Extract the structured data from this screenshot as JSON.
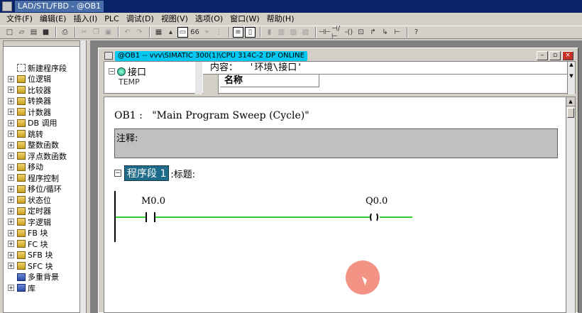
{
  "app": {
    "title": "LAD/STL/FBD  - @OB1"
  },
  "menu": [
    {
      "label": "文件(F)"
    },
    {
      "label": "编辑(E)"
    },
    {
      "label": "插入(I)"
    },
    {
      "label": "PLC"
    },
    {
      "label": "调试(D)"
    },
    {
      "label": "视图(V)"
    },
    {
      "label": "选项(O)"
    },
    {
      "label": "窗口(W)"
    },
    {
      "label": "帮助(H)"
    }
  ],
  "toolbar": {
    "buttons": [
      {
        "icon": "□"
      },
      {
        "icon": "▱"
      },
      {
        "icon": "▤"
      },
      {
        "icon": "■"
      },
      {
        "icon": "⎙"
      },
      {
        "icon": "✂"
      },
      {
        "icon": "❐"
      },
      {
        "icon": "▣"
      },
      {
        "icon": "↶"
      },
      {
        "icon": "↷"
      },
      {
        "icon": "▦"
      },
      {
        "icon": "▴"
      },
      {
        "icon": "▭"
      },
      {
        "icon": "66"
      },
      {
        "icon": "⌖"
      },
      {
        "icon": "⋮"
      },
      {
        "icon": "≡"
      },
      {
        "icon": "▯"
      },
      {
        "icon": "▮"
      },
      {
        "icon": "▥"
      },
      {
        "icon": "▧"
      },
      {
        "icon": "▨"
      },
      {
        "icon": "⊣⊢"
      },
      {
        "icon": "⊣/⊢"
      },
      {
        "icon": "-()"
      },
      {
        "icon": "⊡"
      },
      {
        "icon": "↱"
      },
      {
        "icon": "↳"
      },
      {
        "icon": "⊢"
      },
      {
        "icon": "?"
      }
    ]
  },
  "catalog": {
    "items": [
      {
        "label": "新建程序段",
        "expandable": false
      },
      {
        "label": "位逻辑",
        "expandable": true
      },
      {
        "label": "比较器",
        "expandable": true
      },
      {
        "label": "转换器",
        "expandable": true
      },
      {
        "label": "计数器",
        "expandable": true
      },
      {
        "label": "DB 调用",
        "expandable": true
      },
      {
        "label": "跳转",
        "expandable": true
      },
      {
        "label": "整数函数",
        "expandable": true
      },
      {
        "label": "浮点数函数",
        "expandable": true
      },
      {
        "label": "移动",
        "expandable": true
      },
      {
        "label": "程序控制",
        "expandable": true
      },
      {
        "label": "移位/循环",
        "expandable": true
      },
      {
        "label": "状态位",
        "expandable": true
      },
      {
        "label": "定时器",
        "expandable": true
      },
      {
        "label": "字逻辑",
        "expandable": true
      },
      {
        "label": "FB 块",
        "expandable": true
      },
      {
        "label": "FC 块",
        "expandable": true
      },
      {
        "label": "SFB 块",
        "expandable": true
      },
      {
        "label": "SFC 块",
        "expandable": true
      },
      {
        "label": "多重背景",
        "expandable": false
      },
      {
        "label": "库",
        "expandable": true
      }
    ]
  },
  "window": {
    "title": "@OB1 -- vvv\\SIMATIC 300(1)\\CPU 314C-2 DP  ONLINE",
    "controls": {
      "minimize": "–",
      "restore": "▫",
      "close": "×"
    }
  },
  "interface": {
    "root": "接口",
    "child": "TEMP",
    "content_header": "内容：  '环境\\接口'",
    "column_name": "名称",
    "cell_partial": "TEMP"
  },
  "editor": {
    "block_title": "OB1 :   \"Main Program Sweep (Cycle)\"",
    "comment_label": "注释:",
    "network": {
      "label": "程序段 1",
      "title_label": ":标题:",
      "contact_operand": "M0.0",
      "coil_operand": "Q0.0"
    }
  },
  "colors": {
    "title_bar": "#0a246a",
    "window_title_highlight": "#00c8f0",
    "power_flow": "#33cc33",
    "network_label_bg": "#1e6b8a",
    "cursor_highlight": "#f08070"
  }
}
